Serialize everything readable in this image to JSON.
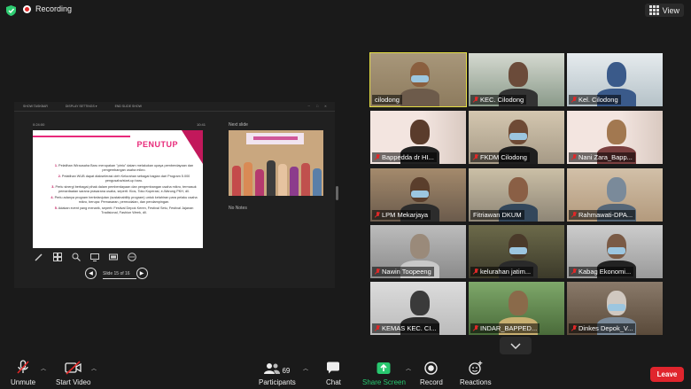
{
  "topbar": {
    "recording_label": "Recording",
    "view_label": "View",
    "shield_color": "#2ecc71"
  },
  "share": {
    "toolbar": [
      "SHOW TASKBAR",
      "DISPLAY SETTINGS ▾",
      "END SLIDE SHOW"
    ],
    "timer": "0:24:00",
    "clock": "10:41",
    "next_slide_label": "Next slide",
    "notes_label": "No Notes",
    "slide": {
      "title": "PENUTUP",
      "points": [
        {
          "num": "1.",
          "text": "Pelatihan Wirausaha Baru merupakan \"pintu\" dalam melakukan upaya pemberdayaan dan pengembangan usaha mikro."
        },
        {
          "num": "2.",
          "text": "Pelatihan WUB dapat diakselerasi oleh Kelurahan sebagai bagian dari Program 5.000 pengusaha/start-up baru."
        },
        {
          "num": "3.",
          "text": "Perlu sinergi berbagai pihak dalam pemberdayaan dan pengembangan usaha mikro, termasuk pemanfaatan sarana prasarana usaha, seperti: Kios, Toko Koperasi, e-Warung PKH, dll."
        },
        {
          "num": "4.",
          "text": "Perlu adanya program berkelanjutan (sustainability program) untuk kelahiran para pelaku usaha mikro, berupa: Pemasaran, permodalan, dan pendampingan."
        },
        {
          "num": "5.",
          "text": "Adakan event yang menarik, seperti: Festival Depok Keren, Festival Setu, Festival Jajanan Tradisional, Fashion Week, dll."
        }
      ]
    },
    "slide_counter": "Slide 15 of 16",
    "slide_current": 15,
    "slide_total": 16
  },
  "participants": [
    {
      "name": "cilodong",
      "muted": false,
      "active": true
    },
    {
      "name": "KEC. Cilodong",
      "muted": true,
      "active": false
    },
    {
      "name": "Kel. Cilodong",
      "muted": true,
      "active": false
    },
    {
      "name": "Bappedda dr HI...",
      "muted": true,
      "active": false
    },
    {
      "name": "FKDM Cilodong",
      "muted": true,
      "active": false
    },
    {
      "name": "Nani Zara_Bapp...",
      "muted": true,
      "active": false
    },
    {
      "name": "LPM Mekarjaya",
      "muted": true,
      "active": false
    },
    {
      "name": "Fitriawan DKUM",
      "muted": false,
      "active": false
    },
    {
      "name": "Rahmawati-DPA...",
      "muted": true,
      "active": false
    },
    {
      "name": "Nawin Toopeeng",
      "muted": true,
      "active": false
    },
    {
      "name": "kelurahan jatim...",
      "muted": true,
      "active": false
    },
    {
      "name": "Kabag Ekonomi...",
      "muted": true,
      "active": false
    },
    {
      "name": "KEMAS KEC. CI...",
      "muted": true,
      "active": false
    },
    {
      "name": "INDAR_BAPPED...",
      "muted": true,
      "active": false
    },
    {
      "name": "Dinkes Depok_V...",
      "muted": true,
      "active": false
    }
  ],
  "toolbar": {
    "unmute": "Unmute",
    "start_video": "Start Video",
    "participants": "Participants",
    "participants_count": "69",
    "chat": "Chat",
    "share_screen": "Share Screen",
    "record": "Record",
    "reactions": "Reactions",
    "leave": "Leave",
    "leave_color": "#e0252d",
    "share_color": "#28c76f"
  }
}
